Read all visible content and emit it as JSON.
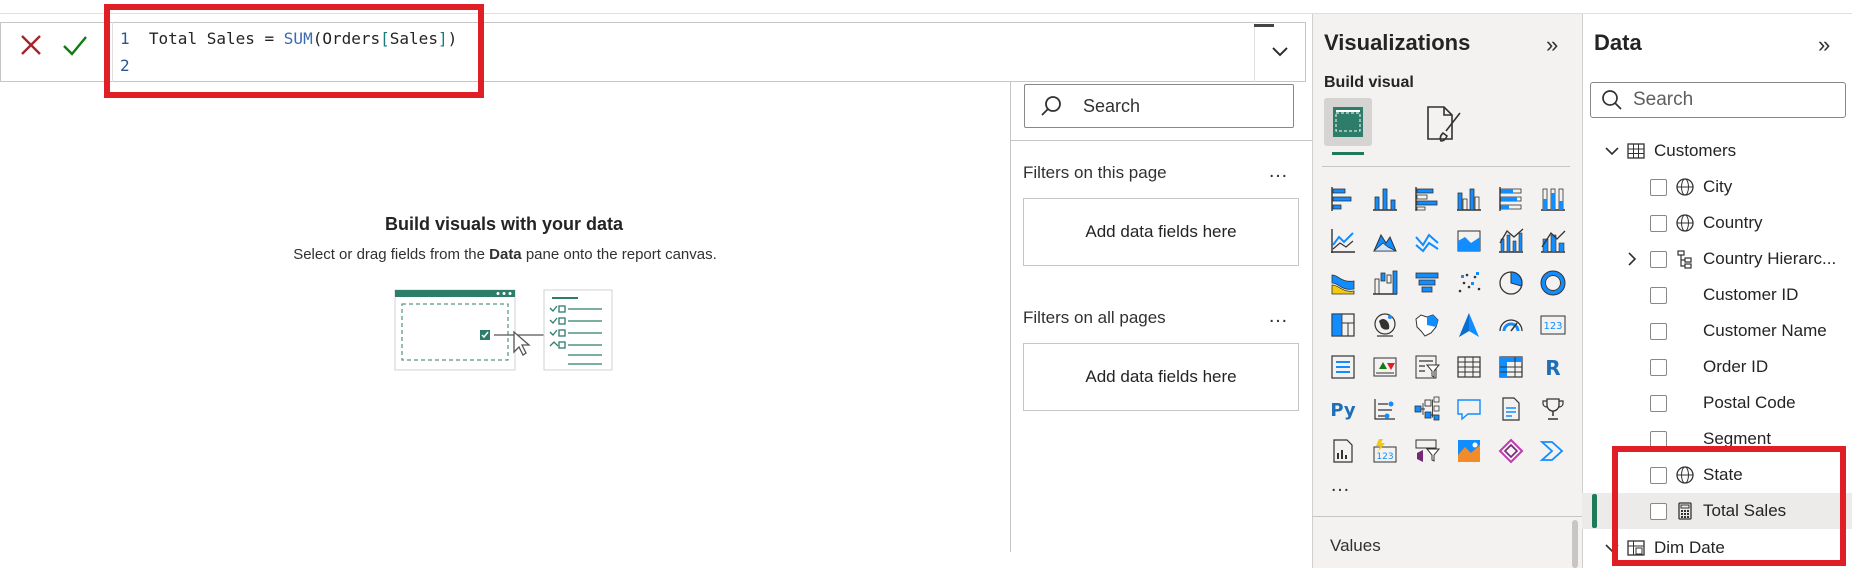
{
  "formula": {
    "line_numbers": [
      "1",
      "2"
    ],
    "name": "Total Sales",
    "equals": "=",
    "function": "SUM",
    "open_paren": "(",
    "table": "Orders",
    "open_bracket": "[",
    "column": "Sales",
    "close_bracket": "]",
    "close_paren": ")"
  },
  "canvas": {
    "title": "Build visuals with your data",
    "subtitle_prefix": "Select or drag fields from the ",
    "subtitle_bold": "Data",
    "subtitle_suffix": " pane onto the report canvas."
  },
  "filters": {
    "search_placeholder": "Search",
    "this_page_label": "Filters on this page",
    "all_pages_label": "Filters on all pages",
    "more": "…",
    "drop_label": "Add data fields here"
  },
  "visualizations": {
    "title": "Visualizations",
    "expand": "»",
    "build_label": "Build visual",
    "more": "…",
    "values_label": "Values",
    "icons": [
      "stacked-bar-icon",
      "stacked-column-icon",
      "clustered-bar-icon",
      "clustered-column-icon",
      "100-stacked-bar-icon",
      "100-stacked-column-icon",
      "line-chart-icon",
      "area-chart-icon",
      "stacked-area-icon",
      "100-stacked-area-icon",
      "line-clustered-column-icon",
      "line-stacked-column-icon",
      "ribbon-chart-icon",
      "waterfall-icon",
      "funnel-icon",
      "scatter-icon",
      "pie-chart-icon",
      "donut-chart-icon",
      "treemap-icon",
      "map-icon",
      "filled-map-icon",
      "azure-map-icon",
      "gauge-icon",
      "card-icon",
      "multi-row-card-icon",
      "kpi-icon",
      "slicer-icon",
      "table-icon",
      "matrix-icon",
      "r-visual-icon",
      "python-visual-icon",
      "key-influencers-icon",
      "decomposition-tree-icon",
      "qa-icon",
      "smart-narrative-icon",
      "goals-icon",
      "paginated-report-icon",
      "new-card-icon",
      "power-apps-icon",
      "arcgis-map-icon",
      "power-automate-icon",
      "more-visuals-icon"
    ]
  },
  "data_pane": {
    "title": "Data",
    "expand": "»",
    "search_placeholder": "Search",
    "table_name": "Customers",
    "fields": [
      {
        "label": "City",
        "icon": "globe-icon"
      },
      {
        "label": "Country",
        "icon": "globe-icon"
      },
      {
        "label": "Country Hierarc...",
        "icon": "hierarchy-icon"
      },
      {
        "label": "Customer ID",
        "icon": ""
      },
      {
        "label": "Customer Name",
        "icon": ""
      },
      {
        "label": "Order ID",
        "icon": ""
      },
      {
        "label": "Postal Code",
        "icon": ""
      },
      {
        "label": "Segment",
        "icon": ""
      },
      {
        "label": "State",
        "icon": "globe-icon"
      },
      {
        "label": "Total Sales",
        "icon": "calculator-icon"
      }
    ],
    "next_table": "Dim Date"
  },
  "colors": {
    "highlight_box": "#e01e26",
    "accent_green": "#1e7a5a",
    "icon_blue": "#118dff",
    "cancel_red": "#a4262c",
    "commit_green": "#107c10"
  }
}
